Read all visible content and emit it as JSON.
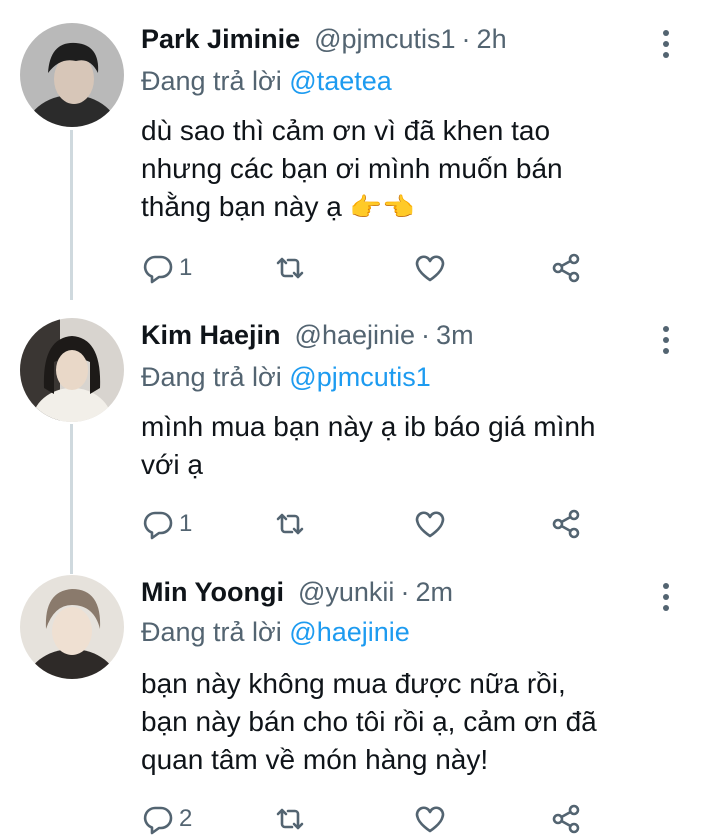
{
  "colors": {
    "accent": "#1d9bf0",
    "muted": "#536471",
    "text": "#0f1419"
  },
  "tweets": [
    {
      "name": "Park Jiminie",
      "handle": "@pjmcutis1",
      "dot": "·",
      "time": "2h",
      "reply_prefix": "Đang trả lời",
      "reply_to": "@taetea",
      "text_lines": [
        "dù sao thì cảm ơn vì đã khen tao",
        "nhưng các bạn ơi mình muốn bán",
        "thằng bạn này ạ"
      ],
      "emoji": "👉👈",
      "reply_count": "1",
      "icons": [
        "reply-icon",
        "retweet-icon",
        "like-icon",
        "share-icon"
      ]
    },
    {
      "name": "Kim Haejin",
      "handle": "@haejinie",
      "dot": "·",
      "time": "3m",
      "reply_prefix": "Đang trả lời",
      "reply_to": "@pjmcutis1",
      "text_lines": [
        "mình mua bạn này ạ ib báo giá mình",
        "với ạ"
      ],
      "reply_count": "1",
      "icons": [
        "reply-icon",
        "retweet-icon",
        "like-icon",
        "share-icon"
      ]
    },
    {
      "name": "Min Yoongi",
      "handle": "@yunkii",
      "dot": "·",
      "time": "2m",
      "reply_prefix": "Đang trả lời",
      "reply_to": "@haejinie",
      "text_lines": [
        "bạn này không mua được nữa rồi,",
        "bạn này bán cho tôi rồi ạ, cảm ơn đã",
        "quan tâm về món hàng này!"
      ],
      "reply_count": "2",
      "icons": [
        "reply-icon",
        "retweet-icon",
        "like-icon",
        "share-icon"
      ]
    }
  ]
}
